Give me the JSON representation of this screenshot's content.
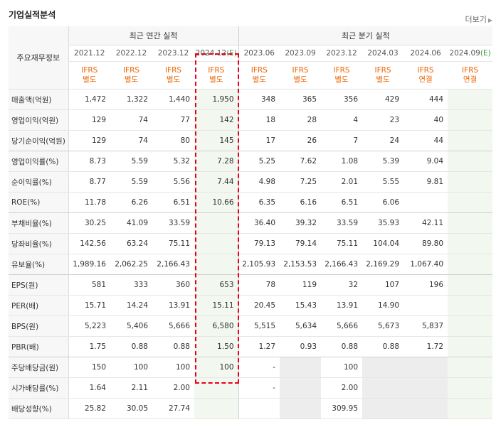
{
  "header": {
    "title": "기업실적분석",
    "more": "더보기"
  },
  "table": {
    "corner": "주요재무정보",
    "group_annual": "최근 연간 실적",
    "group_quarter": "최근 분기 실적",
    "periods": [
      "2021.12",
      "2022.12",
      "2023.12",
      "2024.12(E)",
      "2023.06",
      "2023.09",
      "2023.12",
      "2024.03",
      "2024.06",
      "2024.09(E)"
    ],
    "standards_top": [
      "IFRS",
      "IFRS",
      "IFRS",
      "IFRS",
      "IFRS",
      "IFRS",
      "IFRS",
      "IFRS",
      "IFRS",
      "IFRS"
    ],
    "standards_bottom": [
      "별도",
      "별도",
      "별도",
      "별도",
      "별도",
      "별도",
      "별도",
      "별도",
      "연결",
      "연결"
    ],
    "rows": [
      {
        "label": "매출액(억원)",
        "values": [
          "1,472",
          "1,322",
          "1,440",
          "1,950",
          "348",
          "365",
          "356",
          "429",
          "444",
          ""
        ]
      },
      {
        "label": "영업이익(억원)",
        "values": [
          "129",
          "74",
          "77",
          "142",
          "18",
          "28",
          "4",
          "23",
          "40",
          ""
        ]
      },
      {
        "label": "당기순이익(억원)",
        "values": [
          "129",
          "74",
          "80",
          "145",
          "17",
          "26",
          "7",
          "24",
          "44",
          ""
        ]
      },
      {
        "label": "영업이익률(%)",
        "values": [
          "8.73",
          "5.59",
          "5.32",
          "7.28",
          "5.25",
          "7.62",
          "1.08",
          "5.39",
          "9.04",
          ""
        ]
      },
      {
        "label": "순이익률(%)",
        "values": [
          "8.77",
          "5.59",
          "5.56",
          "7.44",
          "4.98",
          "7.25",
          "2.01",
          "5.55",
          "9.81",
          ""
        ]
      },
      {
        "label": "ROE(%)",
        "values": [
          "11.78",
          "6.26",
          "6.51",
          "10.66",
          "6.35",
          "6.16",
          "6.51",
          "6.06",
          "",
          ""
        ]
      },
      {
        "label": "부채비율(%)",
        "values": [
          "30.25",
          "41.09",
          "33.59",
          "",
          "36.40",
          "39.32",
          "33.59",
          "35.93",
          "42.11",
          ""
        ]
      },
      {
        "label": "당좌비율(%)",
        "values": [
          "142.56",
          "63.24",
          "75.11",
          "",
          "79.13",
          "79.14",
          "75.11",
          "104.04",
          "89.80",
          ""
        ]
      },
      {
        "label": "유보율(%)",
        "values": [
          "1,989.16",
          "2,062.25",
          "2,166.43",
          "",
          "2,105.93",
          "2,153.53",
          "2,166.43",
          "2,169.29",
          "1,067.40",
          ""
        ]
      },
      {
        "label": "EPS(원)",
        "values": [
          "581",
          "333",
          "360",
          "653",
          "78",
          "119",
          "32",
          "107",
          "196",
          ""
        ]
      },
      {
        "label": "PER(배)",
        "values": [
          "15.71",
          "14.24",
          "13.91",
          "15.11",
          "20.45",
          "15.43",
          "13.91",
          "14.90",
          "",
          ""
        ]
      },
      {
        "label": "BPS(원)",
        "values": [
          "5,223",
          "5,406",
          "5,666",
          "6,580",
          "5,515",
          "5,634",
          "5,666",
          "5,673",
          "5,837",
          ""
        ]
      },
      {
        "label": "PBR(배)",
        "values": [
          "1.75",
          "0.88",
          "0.88",
          "1.50",
          "1.27",
          "0.93",
          "0.88",
          "0.88",
          "1.72",
          ""
        ]
      },
      {
        "label": "주당배당금(원)",
        "values": [
          "150",
          "100",
          "100",
          "100",
          "-",
          "",
          "100",
          "",
          "",
          ""
        ]
      },
      {
        "label": "시가배당률(%)",
        "values": [
          "1.64",
          "2.11",
          "2.00",
          "",
          "-",
          "",
          "2.00",
          "",
          "",
          ""
        ]
      },
      {
        "label": "배당성향(%)",
        "values": [
          "25.82",
          "30.05",
          "27.74",
          "",
          "",
          "",
          "309.95",
          "",
          "",
          ""
        ]
      }
    ]
  }
}
